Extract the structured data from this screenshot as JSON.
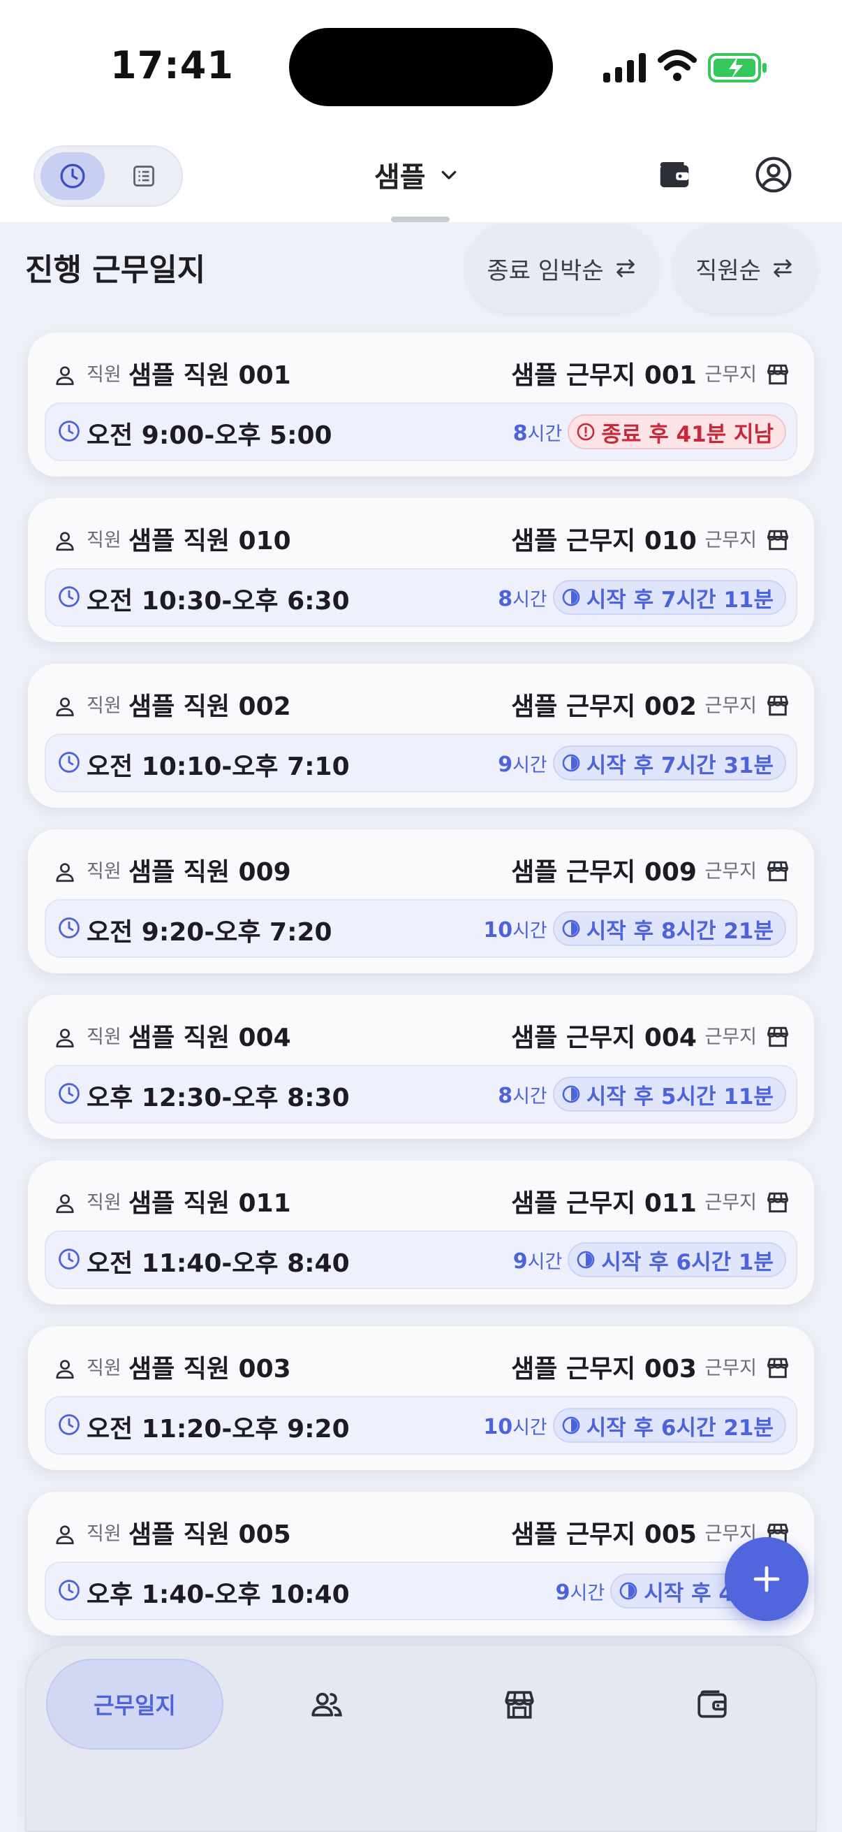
{
  "status_bar": {
    "time": "17:41"
  },
  "header": {
    "title": "샘플"
  },
  "section": {
    "title": "진행 근무일지",
    "sort_end": "종료 임박순",
    "sort_employee": "직원순"
  },
  "labels": {
    "employee": "직원",
    "site": "근무지"
  },
  "cards": [
    {
      "employee": "샘플 직원 001",
      "site": "샘플 근무지 001",
      "hours": "오전 9:00-오후 5:00",
      "duration_num": "8",
      "duration_unit": "시간",
      "status": "종료 후 41분 지남",
      "status_type": "red"
    },
    {
      "employee": "샘플 직원 010",
      "site": "샘플 근무지 010",
      "hours": "오전 10:30-오후 6:30",
      "duration_num": "8",
      "duration_unit": "시간",
      "status": "시작 후 7시간 11분",
      "status_type": "blue"
    },
    {
      "employee": "샘플 직원 002",
      "site": "샘플 근무지 002",
      "hours": "오전 10:10-오후 7:10",
      "duration_num": "9",
      "duration_unit": "시간",
      "status": "시작 후 7시간 31분",
      "status_type": "blue"
    },
    {
      "employee": "샘플 직원 009",
      "site": "샘플 근무지 009",
      "hours": "오전 9:20-오후 7:20",
      "duration_num": "10",
      "duration_unit": "시간",
      "status": "시작 후 8시간 21분",
      "status_type": "blue"
    },
    {
      "employee": "샘플 직원 004",
      "site": "샘플 근무지 004",
      "hours": "오후 12:30-오후 8:30",
      "duration_num": "8",
      "duration_unit": "시간",
      "status": "시작 후 5시간 11분",
      "status_type": "blue"
    },
    {
      "employee": "샘플 직원 011",
      "site": "샘플 근무지 011",
      "hours": "오전 11:40-오후 8:40",
      "duration_num": "9",
      "duration_unit": "시간",
      "status": "시작 후 6시간 1분",
      "status_type": "blue"
    },
    {
      "employee": "샘플 직원 003",
      "site": "샘플 근무지 003",
      "hours": "오전 11:20-오후 9:20",
      "duration_num": "10",
      "duration_unit": "시간",
      "status": "시작 후 6시간 21분",
      "status_type": "blue"
    },
    {
      "employee": "샘플 직원 005",
      "site": "샘플 근무지 005",
      "hours": "오후 1:40-오후 10:40",
      "duration_num": "9",
      "duration_unit": "시간",
      "status": "시작 후 4시간",
      "status_type": "blue"
    }
  ],
  "bottom_nav": {
    "active_label": "근무일지",
    "icons": [
      "people-icon",
      "store-icon",
      "wallet-icon"
    ]
  },
  "colors": {
    "accent": "#4d63d9",
    "alert": "#c62a3a",
    "fab": "#5166dd"
  }
}
